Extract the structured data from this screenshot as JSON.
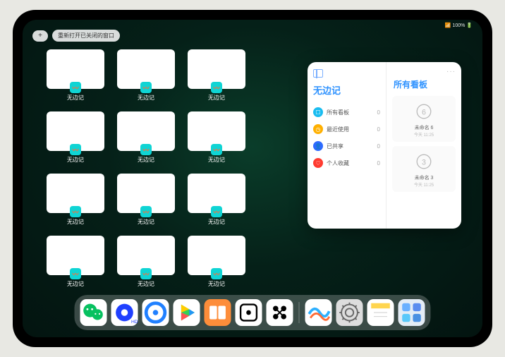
{
  "status": {
    "text": "📶 100% 🔋"
  },
  "top": {
    "plus": "+",
    "pill": "重新打开已关闭的窗口"
  },
  "tiles": [
    {
      "label": "无边记",
      "style": "blank"
    },
    {
      "label": "无边记",
      "style": "grid"
    },
    {
      "label": "无边记",
      "style": "grid"
    },
    {
      "label": "无边记",
      "style": "blank"
    },
    {
      "label": "无边记",
      "style": "grid"
    },
    {
      "label": "无边记",
      "style": "grid"
    },
    {
      "label": "无边记",
      "style": "blank"
    },
    {
      "label": "无边记",
      "style": "grid"
    },
    {
      "label": "无边记",
      "style": "grid"
    },
    {
      "label": "无边记",
      "style": "blank"
    },
    {
      "label": "无边记",
      "style": "grid"
    },
    {
      "label": "无边记",
      "style": "grid"
    }
  ],
  "panel": {
    "title": "无边记",
    "items": [
      {
        "color": "#19bcf0",
        "icon": "☐",
        "label": "所有看板",
        "count": "0"
      },
      {
        "color": "#ffb000",
        "icon": "◷",
        "label": "最近使用",
        "count": "0"
      },
      {
        "color": "#2e6bff",
        "icon": "👤",
        "label": "已共享",
        "count": "0"
      },
      {
        "color": "#ff3b30",
        "icon": "♡",
        "label": "个人收藏",
        "count": "0"
      }
    ],
    "rightTitle": "所有看板",
    "more": "···",
    "boards": [
      {
        "name": "未命名 6",
        "sub": "今天 11:25",
        "digit": "6"
      },
      {
        "name": "未命名 3",
        "sub": "今天 11:25",
        "digit": "3"
      }
    ]
  },
  "dock": {
    "apps": [
      {
        "name": "wechat",
        "bg": "#fff",
        "glyph": "wechat"
      },
      {
        "name": "quark-hd",
        "bg": "#fff",
        "glyph": "quark-hd"
      },
      {
        "name": "quark",
        "bg": "#fff",
        "glyph": "quark"
      },
      {
        "name": "play",
        "bg": "#fff",
        "glyph": "play"
      },
      {
        "name": "books",
        "bg": "#fd8d3a",
        "glyph": "books"
      },
      {
        "name": "dice",
        "bg": "#fff",
        "glyph": "dice"
      },
      {
        "name": "dots",
        "bg": "#fff",
        "glyph": "dots"
      }
    ],
    "recent": [
      {
        "name": "freeform",
        "bg": "#fff",
        "glyph": "freeform"
      },
      {
        "name": "settings",
        "bg": "#ddd",
        "glyph": "settings"
      },
      {
        "name": "notes",
        "bg": "#fff",
        "glyph": "notes"
      },
      {
        "name": "folder",
        "bg": "#e4ecf5",
        "glyph": "folder"
      }
    ]
  }
}
